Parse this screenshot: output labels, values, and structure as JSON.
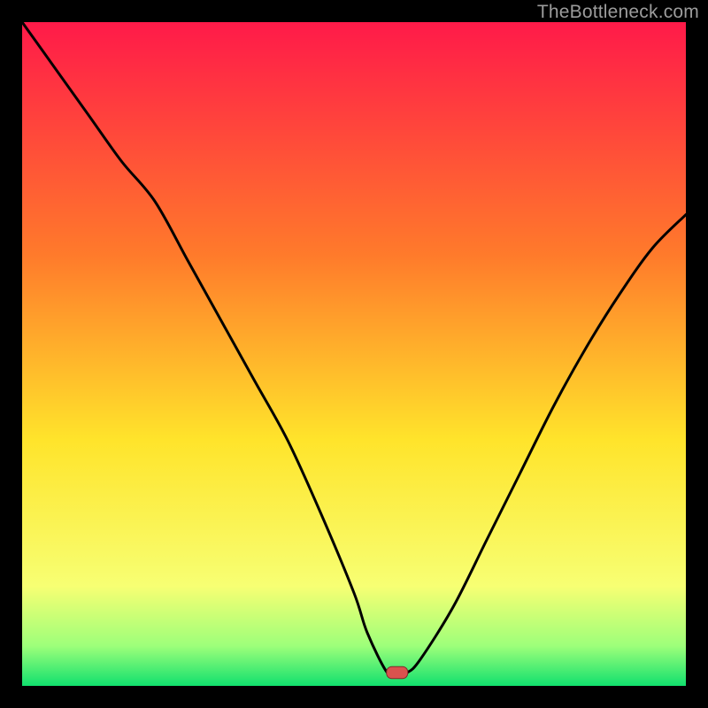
{
  "watermark": "TheBottleneck.com",
  "colors": {
    "bg": "#000000",
    "curve": "#000000",
    "marker_fill": "#d9524e",
    "marker_stroke": "#7e2c2c",
    "grad_top": "#ff1a49",
    "grad_mid1": "#ff7a2b",
    "grad_mid2": "#ffe42b",
    "grad_low": "#f7ff73",
    "grad_green_light": "#9dff7a",
    "grad_green": "#11e06e"
  },
  "chart_data": {
    "type": "line",
    "title": "",
    "xlabel": "",
    "ylabel": "",
    "xlim": [
      0,
      100
    ],
    "ylim": [
      0,
      100
    ],
    "x": [
      0,
      5,
      10,
      15,
      20,
      25,
      30,
      35,
      40,
      45,
      50,
      52,
      55,
      56.5,
      58,
      60,
      65,
      70,
      75,
      80,
      85,
      90,
      95,
      100
    ],
    "values": [
      100,
      93,
      86,
      79,
      73,
      64,
      55,
      46,
      37,
      26,
      14,
      8,
      2,
      2,
      2,
      4,
      12,
      22,
      32,
      42,
      51,
      59,
      66,
      71
    ],
    "marker": {
      "x": 56.5,
      "y": 2,
      "rx": 1.6,
      "ry": 0.9
    },
    "annotations": []
  }
}
